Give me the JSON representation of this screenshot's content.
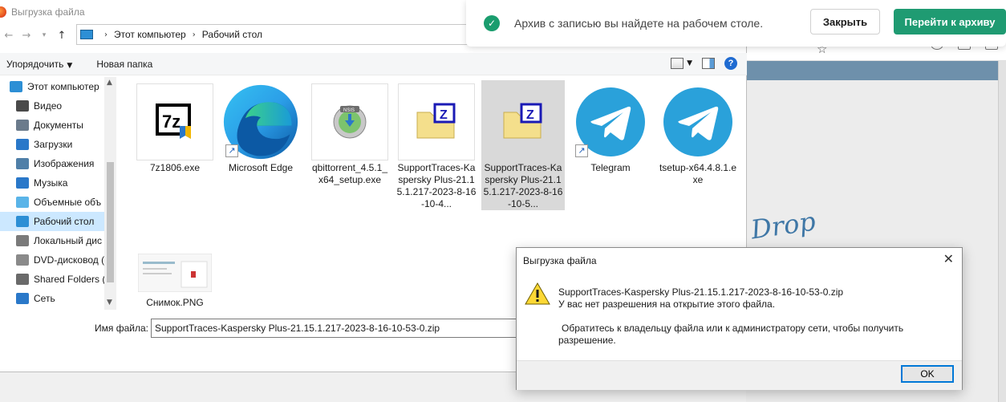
{
  "dialog": {
    "title": "Выгрузка файла",
    "breadcrumb": [
      "Этот компьютер",
      "Рабочий стол"
    ],
    "commands": {
      "organize": "Упорядочить",
      "new_folder": "Новая папка"
    },
    "sidebar": [
      {
        "label": "Этот компьютер",
        "icon": "computer-icon",
        "top": true
      },
      {
        "label": "Видео",
        "icon": "video-icon"
      },
      {
        "label": "Документы",
        "icon": "documents-icon"
      },
      {
        "label": "Загрузки",
        "icon": "downloads-icon"
      },
      {
        "label": "Изображения",
        "icon": "pictures-icon"
      },
      {
        "label": "Музыка",
        "icon": "music-icon"
      },
      {
        "label": "Объемные объ",
        "icon": "3d-objects-icon"
      },
      {
        "label": "Рабочий стол",
        "icon": "desktop-icon",
        "selected": true
      },
      {
        "label": "Локальный дис",
        "icon": "drive-icon"
      },
      {
        "label": "DVD-дисковод (",
        "icon": "dvd-icon"
      },
      {
        "label": "Shared Folders (\\",
        "icon": "network-drive-icon"
      },
      {
        "label": "Сеть",
        "icon": "network-icon"
      }
    ],
    "files": [
      {
        "name": "7z1806.exe",
        "icon": "7zip-icon"
      },
      {
        "name": "Microsoft Edge",
        "icon": "edge-icon",
        "shortcut": true
      },
      {
        "name": "qbittorrent_4.5.1_x64_setup.exe",
        "icon": "nsis-installer-icon"
      },
      {
        "name": "SupportTraces-Kaspersky Plus-21.15.1.217-2023-8-16-10-4...",
        "icon": "zip-folder-icon"
      },
      {
        "name": "SupportTraces-Kaspersky Plus-21.15.1.217-2023-8-16-10-5...",
        "icon": "zip-folder-icon",
        "selected": true
      },
      {
        "name": "Telegram",
        "icon": "telegram-icon",
        "shortcut": true
      },
      {
        "name": "tsetup-x64.4.8.1.exe",
        "icon": "telegram-icon"
      },
      {
        "name": "Снимок.PNG",
        "icon": "screenshot-thumbnail"
      }
    ],
    "filename_label": "Имя файла:",
    "filename_value": "SupportTraces-Kaspersky Plus-21.15.1.217-2023-8-16-10-53-0.zip"
  },
  "notification": {
    "text": "Архив с записью вы найдете на рабочем столе.",
    "close_label": "Закрыть",
    "archive_label": "Перейти к архиву",
    "accent_color": "#1f9b72"
  },
  "error_dialog": {
    "title": "Выгрузка файла",
    "filename": "SupportTraces-Kaspersky Plus-21.15.1.217-2023-8-16-10-53-0.zip",
    "message1": "У вас нет разрешения на открытие этого файла.",
    "message2": "Обратитесь к владельцу файла или к администратору сети, чтобы получить",
    "message3": "разрешение.",
    "ok_label": "OK"
  },
  "background": {
    "drop_text": "Drop"
  }
}
